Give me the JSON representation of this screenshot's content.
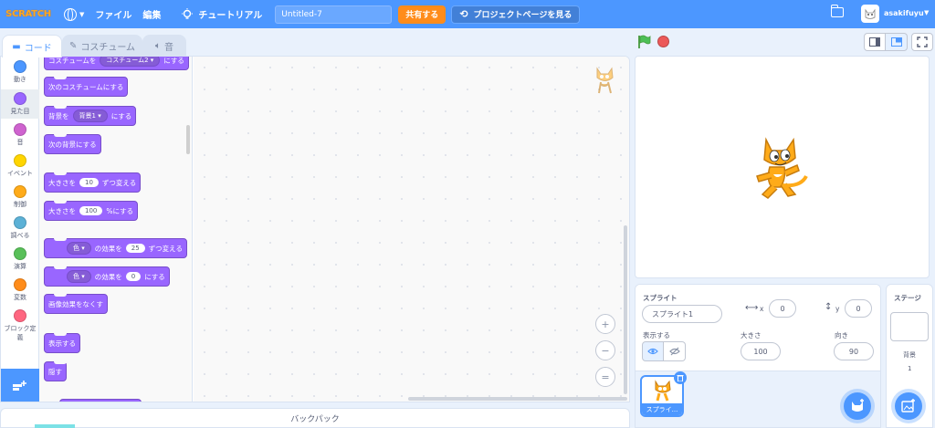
{
  "menubar": {
    "logo": "SCRATCH",
    "file": "ファイル",
    "edit": "編集",
    "tutorials": "チュートリアル",
    "project_title": "Untitled-7",
    "share": "共有する",
    "see_project_page": "プロジェクトページを見る",
    "username": "asakifuyu"
  },
  "tabs": {
    "code": "コード",
    "costumes": "コスチューム",
    "sounds": "音"
  },
  "categories": [
    {
      "label": "動き",
      "color": "#4c97ff"
    },
    {
      "label": "見た目",
      "color": "#9966ff"
    },
    {
      "label": "音",
      "color": "#cf63cf"
    },
    {
      "label": "イベント",
      "color": "#ffd500"
    },
    {
      "label": "制御",
      "color": "#ffab19"
    },
    {
      "label": "調べる",
      "color": "#5cb1d6"
    },
    {
      "label": "演算",
      "color": "#59c059"
    },
    {
      "label": "変数",
      "color": "#ff8c1a"
    },
    {
      "label": "ブロック定義",
      "color": "#ff6680"
    }
  ],
  "blocks": {
    "switch_costume": {
      "pre": "コスチュームを",
      "dd": "コスチューム2",
      "post": "にする"
    },
    "next_costume": "次のコスチュームにする",
    "switch_backdrop": {
      "pre": "背景を",
      "dd": "背景1",
      "post": "にする"
    },
    "next_backdrop": "次の背景にする",
    "change_size": {
      "pre": "大きさを",
      "num": "10",
      "post": "ずつ変える"
    },
    "set_size": {
      "pre": "大きさを",
      "num": "100",
      "post": "%にする"
    },
    "change_effect": {
      "dd": "色",
      "mid": "の効果を",
      "num": "25",
      "post": "ずつ変える"
    },
    "set_effect": {
      "dd": "色",
      "mid": "の効果を",
      "num": "0",
      "post": "にする"
    },
    "clear_effects": "画像効果をなくす",
    "show": "表示する",
    "hide": "隠す"
  },
  "zoom": {
    "in": "+",
    "out": "−",
    "reset": "="
  },
  "backpack": "バックパック",
  "sprite_info": {
    "sprite_label": "スプライト",
    "sprite_name": "スプライト1",
    "x_label": "x",
    "x_value": "0",
    "y_label": "y",
    "y_value": "0",
    "show_label": "表示する",
    "size_label": "大きさ",
    "size_value": "100",
    "direction_label": "向き",
    "direction_value": "90"
  },
  "sprite_list": [
    {
      "name": "スプライ..."
    }
  ],
  "stage_pane": {
    "title": "ステージ",
    "backdrops_label": "背景",
    "backdrops_count": "1"
  },
  "colors": {
    "accent": "#4c97ff",
    "looks": "#9966ff",
    "share": "#ff8c1a"
  }
}
